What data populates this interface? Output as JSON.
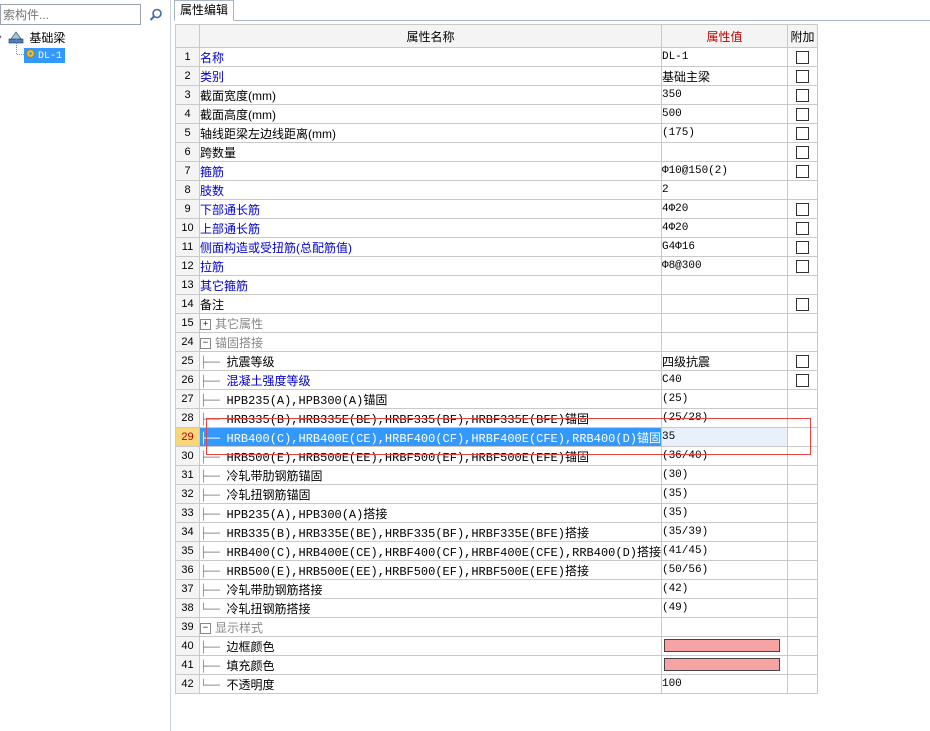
{
  "search": {
    "placeholder": "索构件..."
  },
  "tree": {
    "root_label": "基础梁",
    "child_label": "DL-1"
  },
  "tab": {
    "label": "属性编辑"
  },
  "table": {
    "headers": {
      "name": "属性名称",
      "value": "属性值",
      "extra": "附加"
    },
    "rows": [
      {
        "num": "1",
        "name": "名称",
        "value": "DL-1"
      },
      {
        "num": "2",
        "name": "类别",
        "value": "基础主梁"
      },
      {
        "num": "3",
        "name": "截面宽度(mm)",
        "value": "350"
      },
      {
        "num": "4",
        "name": "截面高度(mm)",
        "value": "500"
      },
      {
        "num": "5",
        "name": "轴线距梁左边线距离(mm)",
        "value": "(175)"
      },
      {
        "num": "6",
        "name": "跨数量",
        "value": ""
      },
      {
        "num": "7",
        "name": "箍筋",
        "value": "Φ10@150(2)"
      },
      {
        "num": "8",
        "name": "肢数",
        "value": "2"
      },
      {
        "num": "9",
        "name": "下部通长筋",
        "value": "4Φ20"
      },
      {
        "num": "10",
        "name": "上部通长筋",
        "value": "4Φ20"
      },
      {
        "num": "11",
        "name": "侧面构造或受扭筋(总配筋值)",
        "value": "G4Φ16"
      },
      {
        "num": "12",
        "name": "拉筋",
        "value": "Φ8@300"
      },
      {
        "num": "13",
        "name": "其它箍筋",
        "value": ""
      },
      {
        "num": "14",
        "name": "备注",
        "value": ""
      },
      {
        "num": "15",
        "name": "其它属性",
        "value": ""
      },
      {
        "num": "24",
        "name": "锚固搭接",
        "value": ""
      },
      {
        "num": "25",
        "name": "抗震等级",
        "value": "四级抗震"
      },
      {
        "num": "26",
        "name": "混凝土强度等级",
        "value": "C40"
      },
      {
        "num": "27",
        "name": "HPB235(A),HPB300(A)锚固",
        "value": "(25)"
      },
      {
        "num": "28",
        "name": "HRB335(B),HRB335E(BE),HRBF335(BF),HRBF335E(BFE)锚固",
        "value": "(25/28)"
      },
      {
        "num": "29",
        "name": "HRB400(C),HRB400E(CE),HRBF400(CF),HRBF400E(CFE),RRB400(D)锚固",
        "value": "35"
      },
      {
        "num": "30",
        "name": "HRB500(E),HRB500E(EE),HRBF500(EF),HRBF500E(EFE)锚固",
        "value": "(36/40)"
      },
      {
        "num": "31",
        "name": "冷轧带肋钢筋锚固",
        "value": "(30)"
      },
      {
        "num": "32",
        "name": "冷轧扭钢筋锚固",
        "value": "(35)"
      },
      {
        "num": "33",
        "name": "HPB235(A),HPB300(A)搭接",
        "value": "(35)"
      },
      {
        "num": "34",
        "name": "HRB335(B),HRB335E(BE),HRBF335(BF),HRBF335E(BFE)搭接",
        "value": "(35/39)"
      },
      {
        "num": "35",
        "name": "HRB400(C),HRB400E(CE),HRBF400(CF),HRBF400E(CFE),RRB400(D)搭接",
        "value": "(41/45)"
      },
      {
        "num": "36",
        "name": "HRB500(E),HRB500E(EE),HRBF500(EF),HRBF500E(EFE)搭接",
        "value": "(50/56)"
      },
      {
        "num": "37",
        "name": "冷轧带肋钢筋搭接",
        "value": "(42)"
      },
      {
        "num": "38",
        "name": "冷轧扭钢筋搭接",
        "value": "(49)"
      },
      {
        "num": "39",
        "name": "显示样式",
        "value": ""
      },
      {
        "num": "40",
        "name": "边框颜色",
        "value": ""
      },
      {
        "num": "41",
        "name": "填充颜色",
        "value": ""
      },
      {
        "num": "42",
        "name": "不透明度",
        "value": "100"
      }
    ]
  },
  "colors": {
    "swatch": "#f7a3a3",
    "selection": "#3399ff",
    "highlight_box": "#e24444",
    "link_text": "#0000cc"
  },
  "icons": {
    "search": "magnifier-icon",
    "tree_root": "beam-icon",
    "tree_child": "gear-icon"
  }
}
